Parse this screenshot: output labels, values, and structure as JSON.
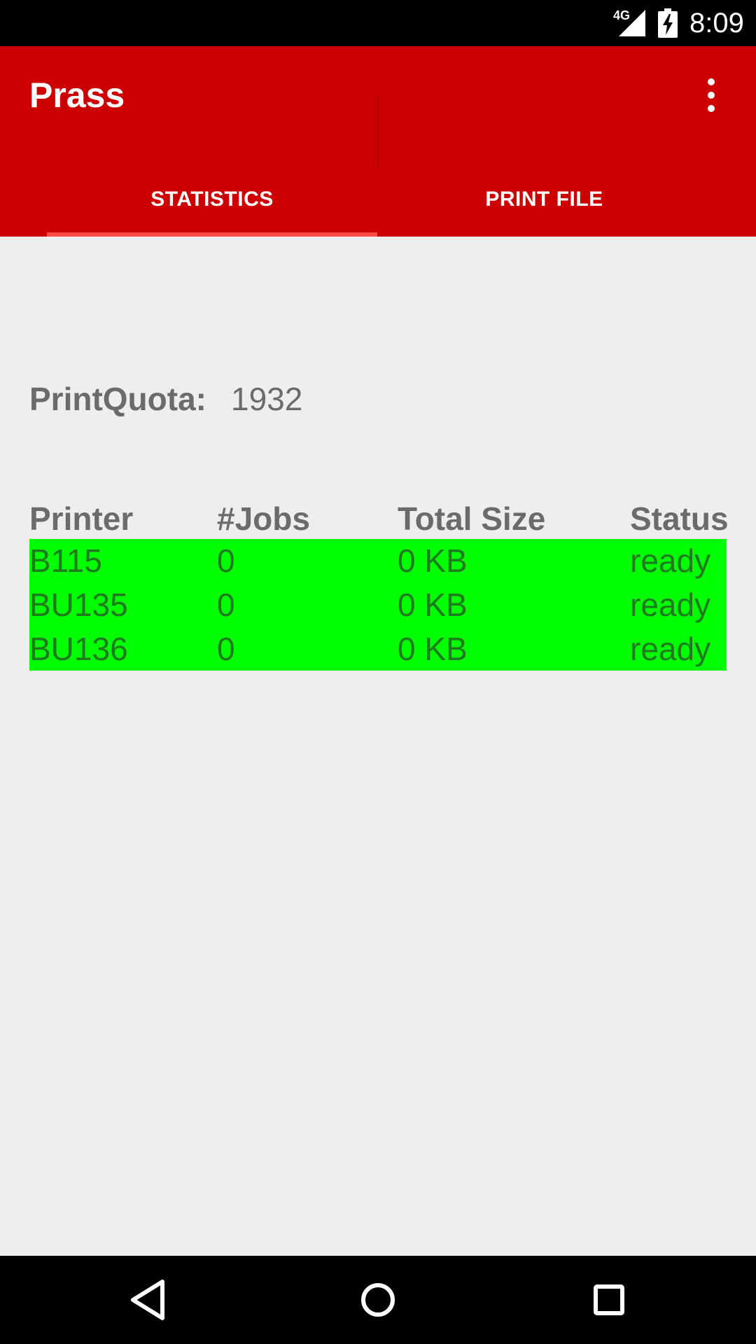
{
  "status_bar": {
    "network": "4G",
    "time": "8:09",
    "icons": [
      "signal-icon",
      "battery-charging-icon"
    ]
  },
  "app_bar": {
    "title": "Prass",
    "menu_icon": "more-vert-icon",
    "tabs": [
      {
        "label": "STATISTICS",
        "selected": true
      },
      {
        "label": "PRINT FILE",
        "selected": false
      }
    ]
  },
  "quota": {
    "label": "PrintQuota:",
    "value": "1932"
  },
  "table": {
    "headers": [
      "Printer",
      "#Jobs",
      "Total Size",
      "Status"
    ],
    "rows": [
      [
        "B115",
        "0",
        "0 KB",
        "ready"
      ],
      [
        "BU135",
        "0",
        "0 KB",
        "ready"
      ],
      [
        "BU136",
        "0",
        "0 KB",
        "ready"
      ]
    ],
    "row_color": "#00ff00"
  },
  "colors": {
    "app_bar": "#cc0000",
    "tab_indicator": "#ff4a4a",
    "background": "#eeeeee"
  },
  "nav_bar": {
    "icons": [
      "back-icon",
      "home-icon",
      "recents-icon"
    ]
  }
}
